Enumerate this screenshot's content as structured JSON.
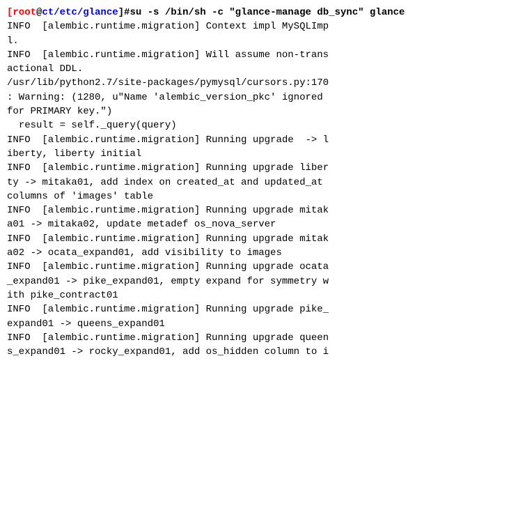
{
  "terminal": {
    "prompt": {
      "root": "[root",
      "at": "@",
      "path": "ct/etc/glance",
      "hash": "]#",
      "command": "su -s /bin/sh -c \"glance-manage db_sync\" glance"
    },
    "lines": [
      "INFO  [alembic.runtime.migration] Context impl MySQLImpl.",
      "INFO  [alembic.runtime.migration] Will assume non-transactional DDL.",
      "/usr/lib/python2.7/site-packages/pymysql/cursors.py:170: Warning: (1280, u\"Name 'alembic_version_pkc' ignored for PRIMARY key.\")",
      "  result = self._query(query)",
      "INFO  [alembic.runtime.migration] Running upgrade  -> liberty, liberty initial",
      "INFO  [alembic.runtime.migration] Running upgrade liberty -> mitaka01, add index on created_at and updated_at columns of 'images' table",
      "INFO  [alembic.runtime.migration] Running upgrade mitaka01 -> mitaka02, update metadef os_nova_server",
      "INFO  [alembic.runtime.migration] Running upgrade mitaka02 -> ocata_expand01, add visibility to images",
      "INFO  [alembic.runtime.migration] Running upgrade ocata_expand01 -> pike_expand01, empty expand for symmetry with pike_contract01",
      "INFO  [alembic.runtime.migration] Running upgrade pike_expand01 -> queens_expand01",
      "INFO  [alembic.runtime.migration] Running upgrade queens_expand01 -> rocky_expand01, add os_hidden column to i"
    ]
  }
}
